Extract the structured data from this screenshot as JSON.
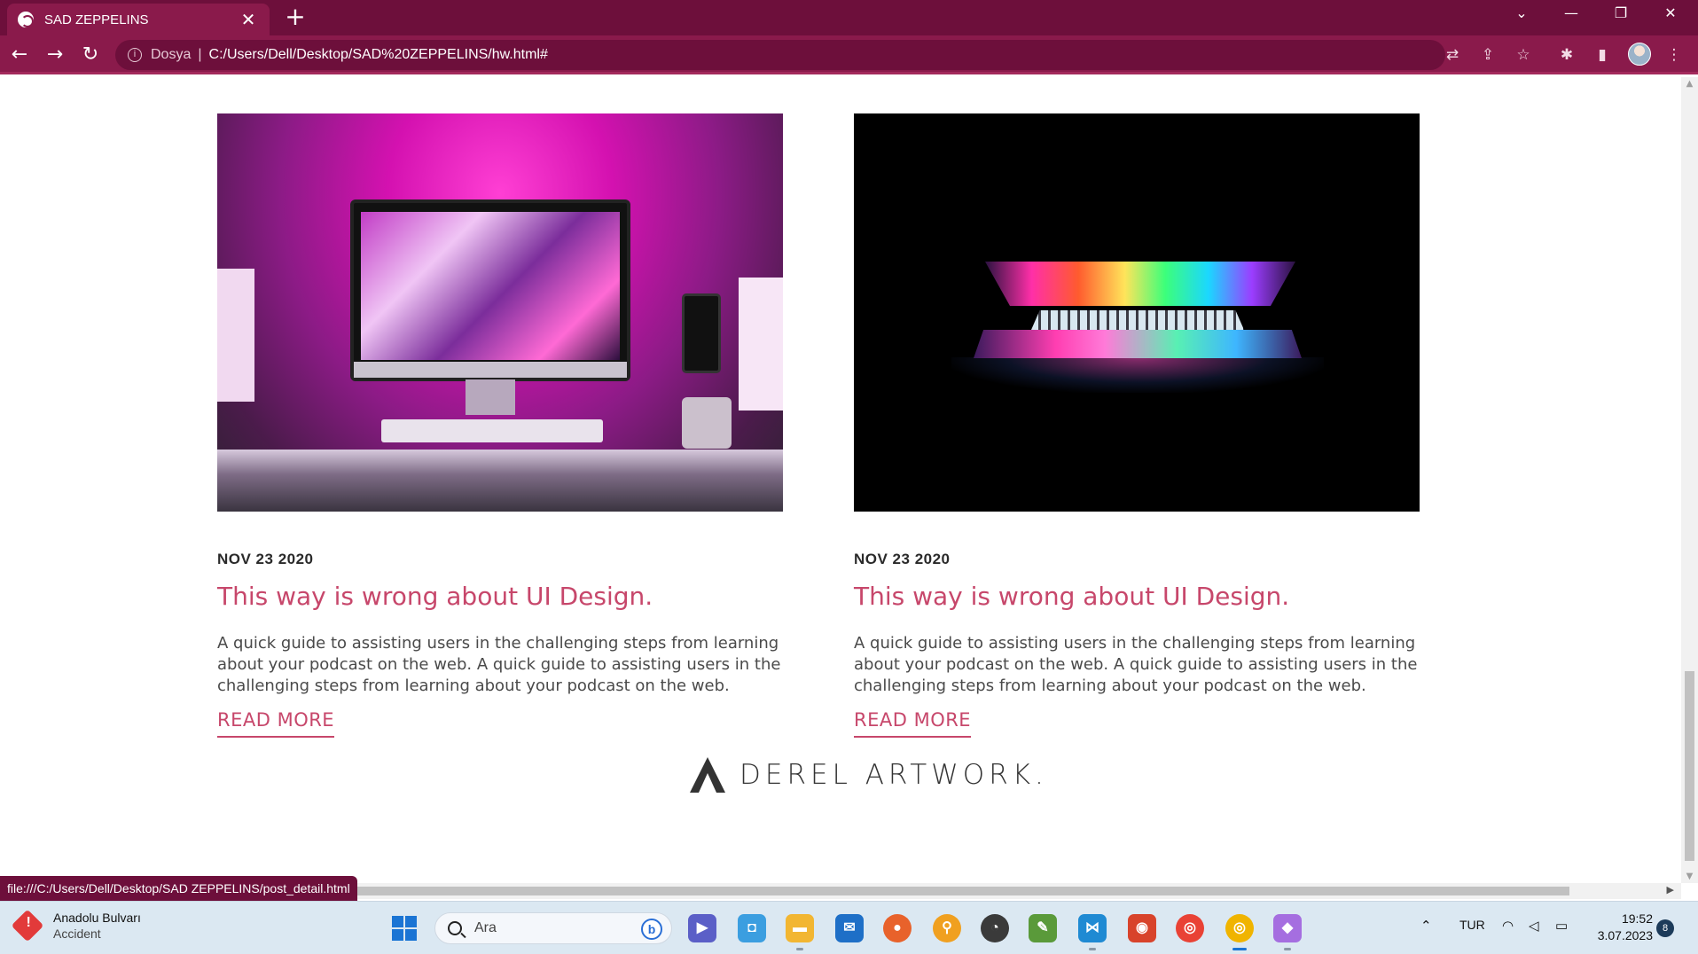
{
  "browser": {
    "tab_title": "SAD ZEPPELINS",
    "tab_close": "✕",
    "new_tab": "+",
    "scheme_label": "Dosya",
    "url": "C:/Users/Dell/Desktop/SAD%20ZEPPELINS/hw.html#",
    "status_url": "file:///C:/Users/Dell/Desktop/SAD ZEPPELINS/post_detail.html"
  },
  "posts": [
    {
      "date": "NOV 23 2020",
      "title": "This way is wrong about UI Design.",
      "excerpt": "A quick guide to assisting users in the challenging steps from learning about your podcast on the web. A quick guide to assisting users in the challenging steps from learning about your podcast on the web.",
      "link": "READ MORE"
    },
    {
      "date": "NOV 23 2020",
      "title": "This way is wrong about UI Design.",
      "excerpt": "A quick guide to assisting users in the challenging steps from learning about your podcast on the web. A quick guide to assisting users in the challenging steps from learning about your podcast on the web.",
      "link": "READ MORE"
    }
  ],
  "footer": {
    "brand": "DEREL ARTWORK."
  },
  "taskbar": {
    "weather_title": "Anadolu Bulvarı",
    "weather_sub": "Accident",
    "search_placeholder": "Ara",
    "language": "TUR",
    "time": "19:52",
    "date": "3.07.2023",
    "notification_count": "8"
  },
  "colors": {
    "chrome_dark": "#6d0f3b",
    "chrome": "#8a1a4b",
    "accent": "#c7476b"
  }
}
